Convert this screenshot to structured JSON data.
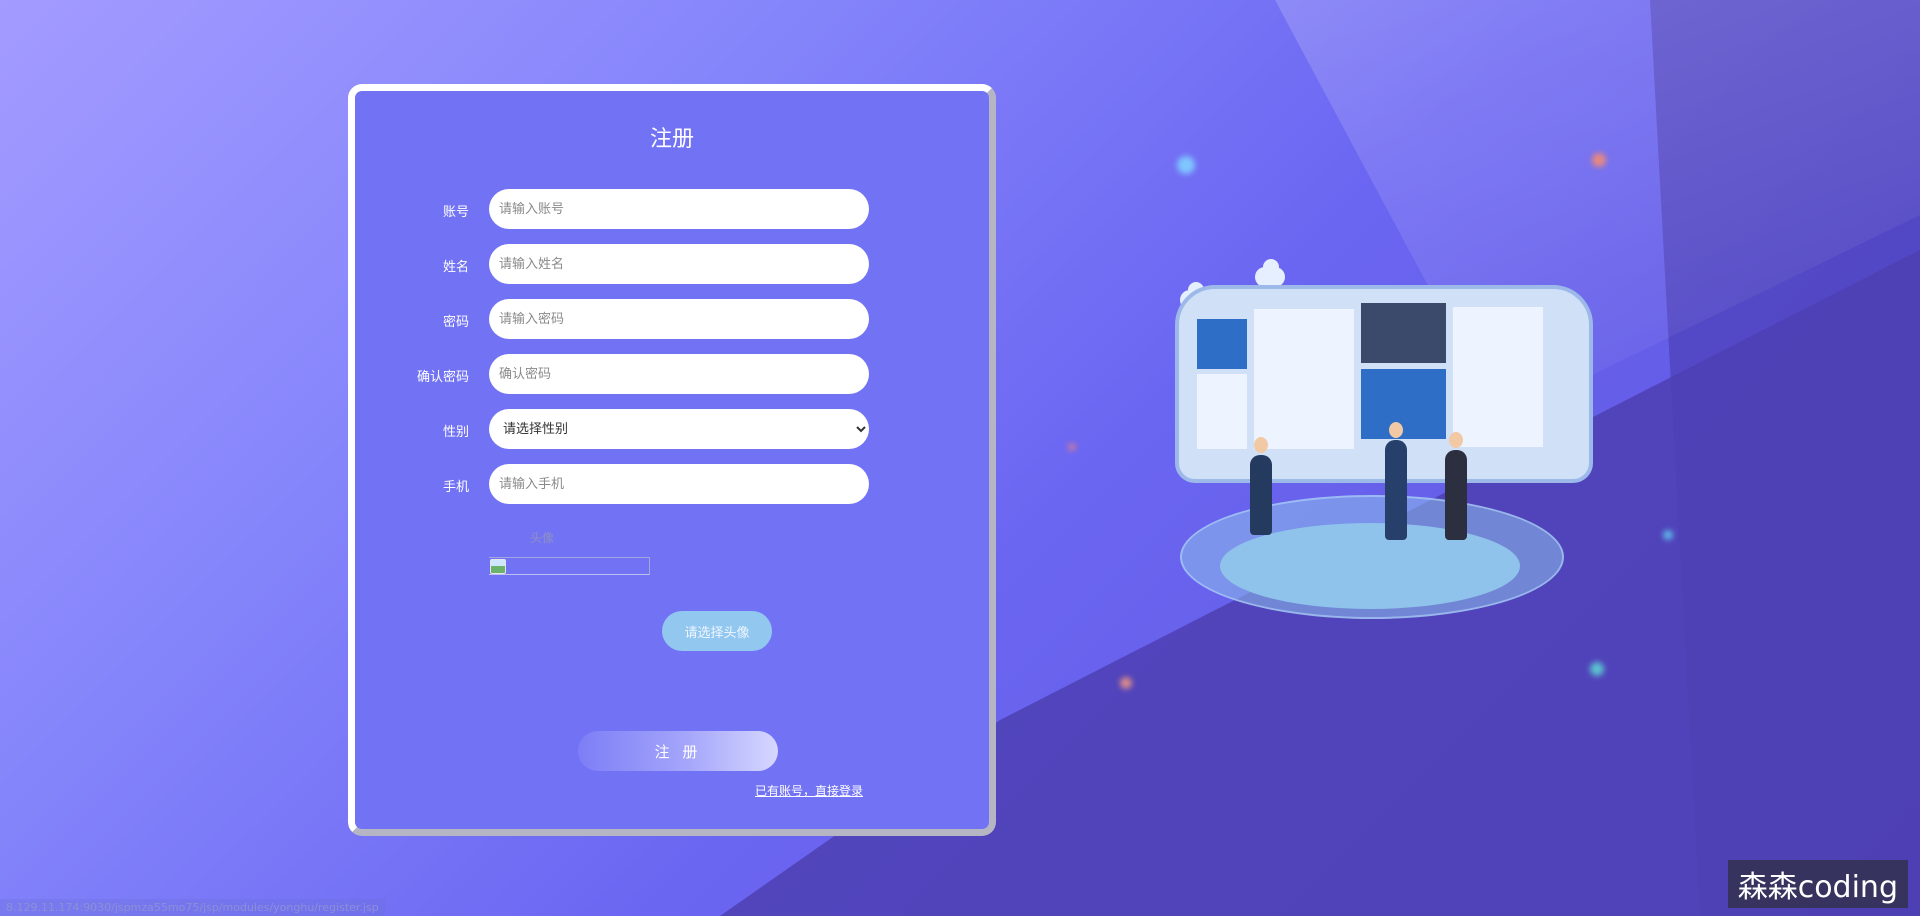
{
  "form": {
    "title": "注册",
    "fields": [
      {
        "label": "账号",
        "placeholder": "请输入账号"
      },
      {
        "label": "姓名",
        "placeholder": "请输入姓名"
      },
      {
        "label": "密码",
        "placeholder": "请输入密码"
      },
      {
        "label": "确认密码",
        "placeholder": "确认密码"
      },
      {
        "label": "性别",
        "selected": "请选择性别"
      },
      {
        "label": "手机",
        "placeholder": "请输入手机"
      }
    ],
    "avatar_label": "头像",
    "avatar_button": "请选择头像",
    "submit_label": "注 册",
    "login_link": "已有账号，直接登录"
  },
  "status_url": "8.129.11.174:9030/jspmza55mo75/jsp/modules/yonghu/register.jsp",
  "watermark": "森森coding",
  "colors": {
    "panel": "#7273f4",
    "button_avatar": "#92c7f0",
    "background_start": "#a39bff",
    "background_end": "#5a4fd6"
  }
}
